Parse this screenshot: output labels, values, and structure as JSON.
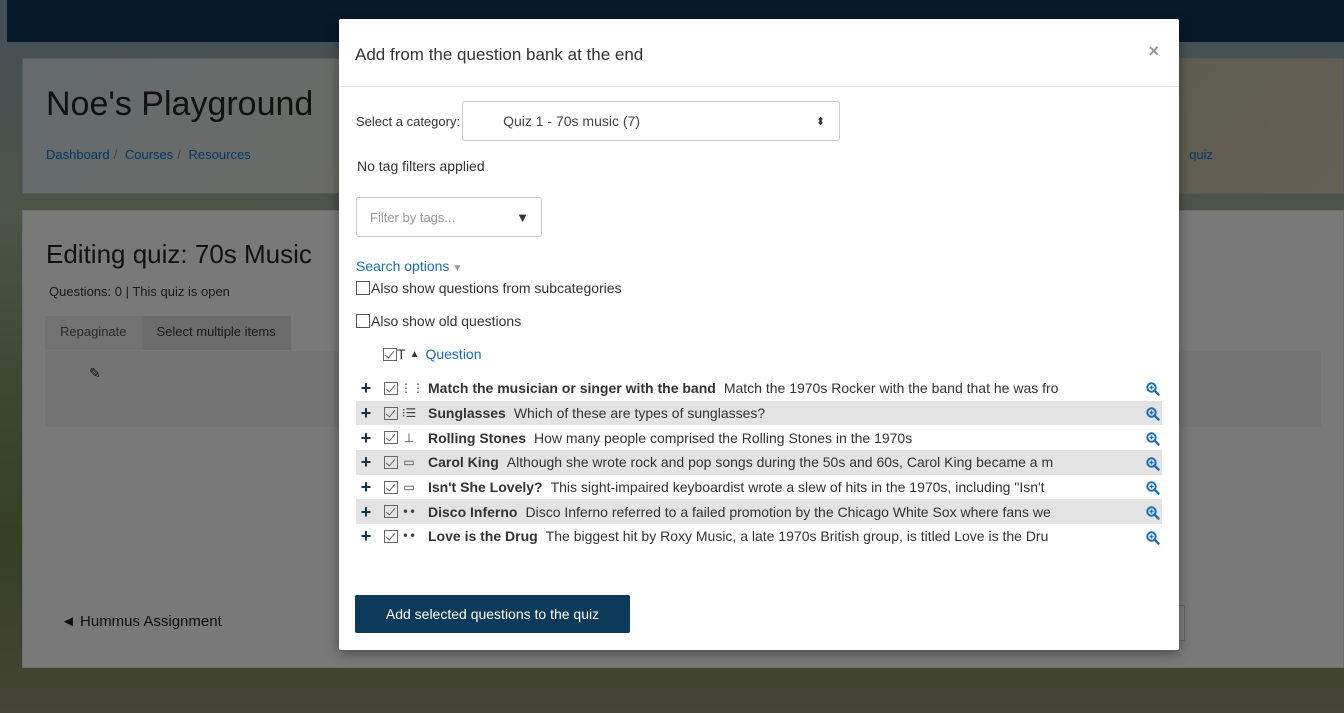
{
  "page": {
    "site_title": "Noe's Playground",
    "breadcrumb": [
      "Dashboard",
      "Courses",
      "Resources"
    ],
    "breadcrumb_tail": "quiz",
    "editing_title": "Editing quiz: 70s Music",
    "questions_info": "Questions: 0 | This quiz is open",
    "repaginate": "Repaginate",
    "select_multiple": "Select multiple items",
    "prev_link": "◄ Hummus Assignment"
  },
  "modal": {
    "title": "Add from the question bank at the end",
    "close": "×",
    "category_label": "Select a category:",
    "category_value": "Quiz 1 - 70s music (7)",
    "no_tags": "No tag filters applied",
    "tag_placeholder": "Filter by tags...",
    "search_options": "Search options",
    "subcategories_label": "Also show questions from subcategories",
    "old_questions_label": "Also show old questions",
    "header_sort": "T",
    "header_question": "Question",
    "questions": [
      {
        "icon": "matching-icon",
        "glyph": "⋮⋮",
        "name": "Match the musician or singer with the band",
        "text": "Match the 1970s Rocker with the band that he was fro"
      },
      {
        "icon": "multichoice-icon",
        "glyph": "⁝☰",
        "name": "Sunglasses",
        "text": "Which of these are types of sunglasses?"
      },
      {
        "icon": "numerical-icon",
        "glyph": "⊥",
        "name": "Rolling Stones",
        "text": "How many people comprised the Rolling Stones in the 1970s"
      },
      {
        "icon": "shortanswer-icon",
        "glyph": "▭",
        "name": "Carol King",
        "text": "Although she wrote rock and pop songs during the 50s and 60s, Carol King became a m"
      },
      {
        "icon": "shortanswer-icon",
        "glyph": "▭",
        "name": "Isn't She Lovely?",
        "text": "This sight-impaired keyboardist wrote a slew of hits in the 1970s, including \"Isn't"
      },
      {
        "icon": "truefalse-icon",
        "glyph": "••",
        "name": "Disco Inferno",
        "text": "Disco Inferno referred to a failed promotion by the Chicago White Sox where fans we"
      },
      {
        "icon": "truefalse-icon",
        "glyph": "••",
        "name": "Love is the Drug",
        "text": "The biggest hit by Roxy Music, a late 1970s British group,  is titled Love is the Dru"
      }
    ],
    "add_button": "Add selected questions to the quiz"
  }
}
